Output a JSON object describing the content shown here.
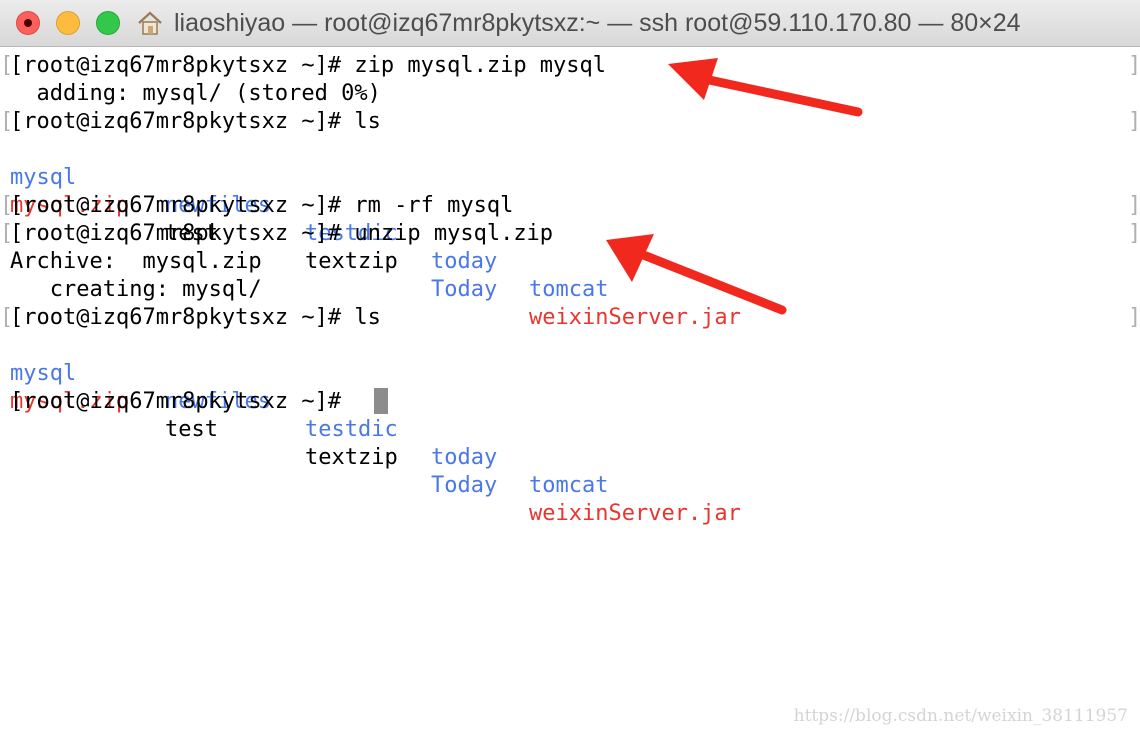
{
  "window": {
    "title": "liaoshiyao — root@izq67mr8pkytsxz:~ — ssh root@59.110.170.80 — 80×24",
    "icon": "home-icon"
  },
  "terminal": {
    "lines": [
      "[root@izq67mr8pkytsxz ~]# zip mysql.zip mysql",
      "  adding: mysql/ (stored 0%)",
      "[root@izq67mr8pkytsxz ~]# ls",
      "[root@izq67mr8pkytsxz ~]# rm -rf mysql",
      "[root@izq67mr8pkytsxz ~]# unzip mysql.zip",
      "Archive:  mysql.zip",
      "   creating: mysql/",
      "[root@izq67mr8pkytsxz ~]# ls",
      "[root@izq67mr8pkytsxz ~]# "
    ],
    "ls_output": {
      "row1": [
        "mysql",
        "newfiles",
        "testdic",
        "today",
        "tomcat"
      ],
      "row2": [
        "mysql.zip",
        "test",
        "textzip",
        "Today",
        "weixinServer.jar"
      ]
    },
    "bracket_left": "[",
    "bracket_right": "]"
  },
  "colors": {
    "directory": "#4a78e8",
    "archive": "#e8352e",
    "arrow": "#f0281e"
  },
  "watermark": "https://blog.csdn.net/weixin_38111957"
}
